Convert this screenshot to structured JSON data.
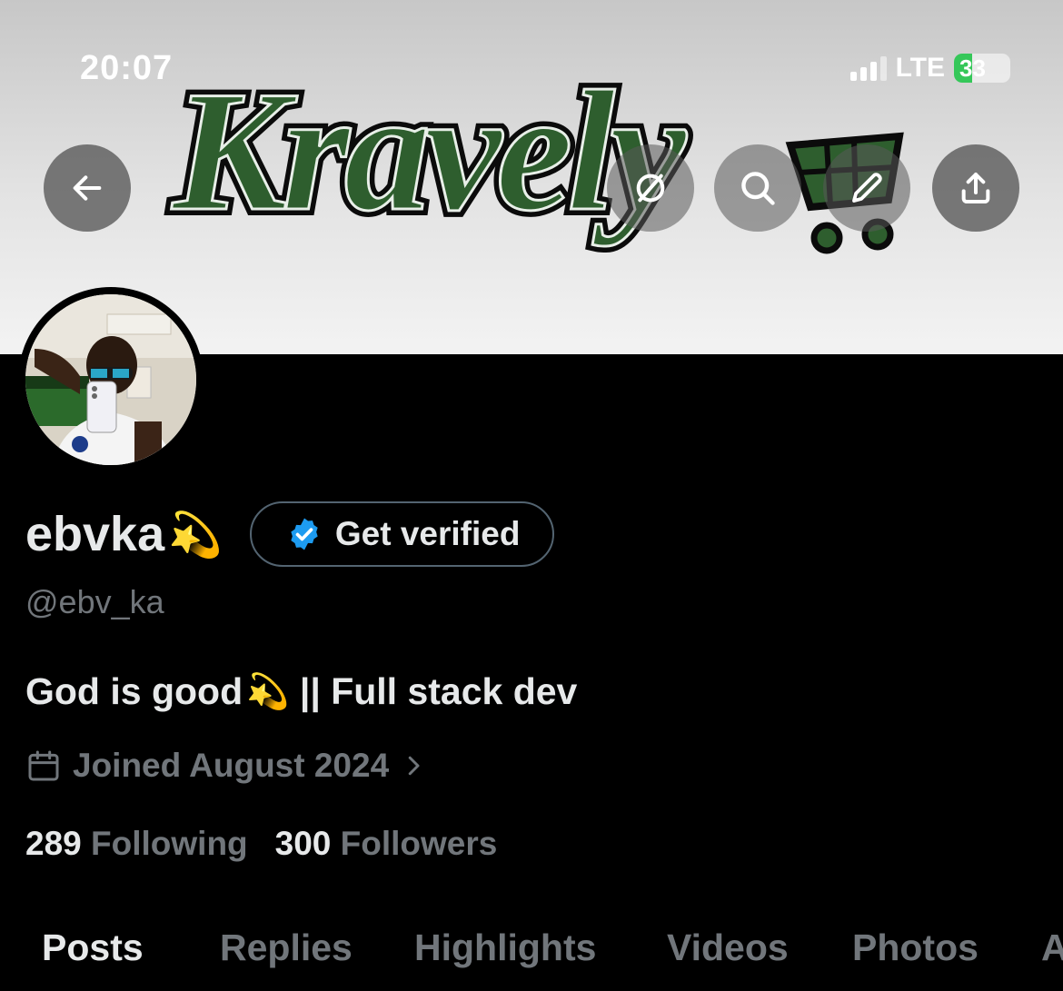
{
  "status_bar": {
    "time": "20:07",
    "network": "LTE",
    "battery": "33",
    "battery_level": 0.33
  },
  "header": {
    "banner_logo_text": "Kravely",
    "buttons": {
      "back_icon": "arrow-left-icon",
      "grok_icon": "grok-icon",
      "search_icon": "search-icon",
      "edit_icon": "pencil-icon",
      "share_icon": "share-icon"
    }
  },
  "profile": {
    "display_name": "ebvka",
    "name_emoji": "💫",
    "get_verified_label": "Get verified",
    "handle": "@ebv_ka",
    "bio_part1": "God is good",
    "bio_emoji": "💫",
    "bio_part2": " || Full stack dev",
    "joined": "Joined August 2024",
    "following_count": "289",
    "following_label": "Following",
    "followers_count": "300",
    "followers_label": "Followers"
  },
  "tabs": [
    {
      "label": "Posts"
    },
    {
      "label": "Replies"
    },
    {
      "label": "Highlights"
    },
    {
      "label": "Videos"
    },
    {
      "label": "Photos"
    },
    {
      "label": "A"
    }
  ],
  "colors": {
    "background": "#000000",
    "primary_text": "#e7e9ea",
    "secondary_text": "#71767b",
    "verified_blue": "#1d9bf0",
    "logo_green": "#2e5e2e"
  }
}
